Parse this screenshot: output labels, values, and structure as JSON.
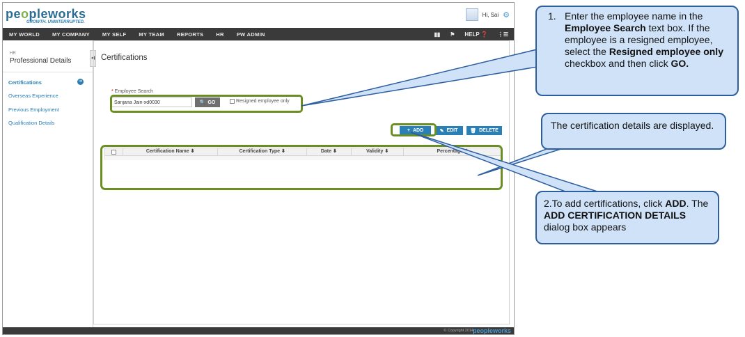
{
  "app": {
    "logo_main": "pe",
    "logo_accent": "o",
    "logo_rest": "pleworks",
    "tagline": "GROWTH. UNINTERRUPTED.",
    "greeting": "Hi, Sai"
  },
  "nav": {
    "items": [
      "MY WORLD",
      "MY COMPANY",
      "MY SELF",
      "MY TEAM",
      "REPORTS",
      "HR",
      "PW ADMIN"
    ],
    "help_label": "HELP"
  },
  "sidebar": {
    "section": "HR",
    "title": "Professional Details",
    "links": [
      "Certifications",
      "Overseas Experience",
      "Previous Employment",
      "Qualification Details"
    ]
  },
  "main": {
    "title": "Certifications",
    "search_label": "Employee Search",
    "search_value": "Sanjana Jain-xd0030",
    "go_label": "GO",
    "resigned_label": "Resigned employee only",
    "add_label": "ADD",
    "edit_label": "EDIT",
    "delete_label": "DELETE",
    "columns": [
      "Certification Name",
      "Certification Type",
      "Date",
      "Validity",
      "Percentage"
    ]
  },
  "footer": {
    "copyright": "© Copyright 2014",
    "logo": "peopleworks"
  },
  "callouts": {
    "search": {
      "num": "1.",
      "t1": "Enter the employee name in the ",
      "b1": "Employee Search",
      "t2": "  text box. If the employee is a resigned employee, select  the ",
      "b2": "Resigned employee only",
      "t3": " checkbox and then  click ",
      "b3": "GO."
    },
    "table": {
      "text": "The certification details are displayed."
    },
    "add": {
      "t1": "2.To add  certifications, click ",
      "b1": "ADD",
      "t2": ". The ",
      "b2": "ADD CERTIFICATION DETAILS",
      "t3": " dialog box appears"
    }
  },
  "colors": {
    "accent_blue": "#2a7fb4",
    "nav_dark": "#3a3a3a",
    "highlight_green": "#6b8e23",
    "callout_fill": "#cfe2f8",
    "callout_border": "#2d5e9e"
  }
}
